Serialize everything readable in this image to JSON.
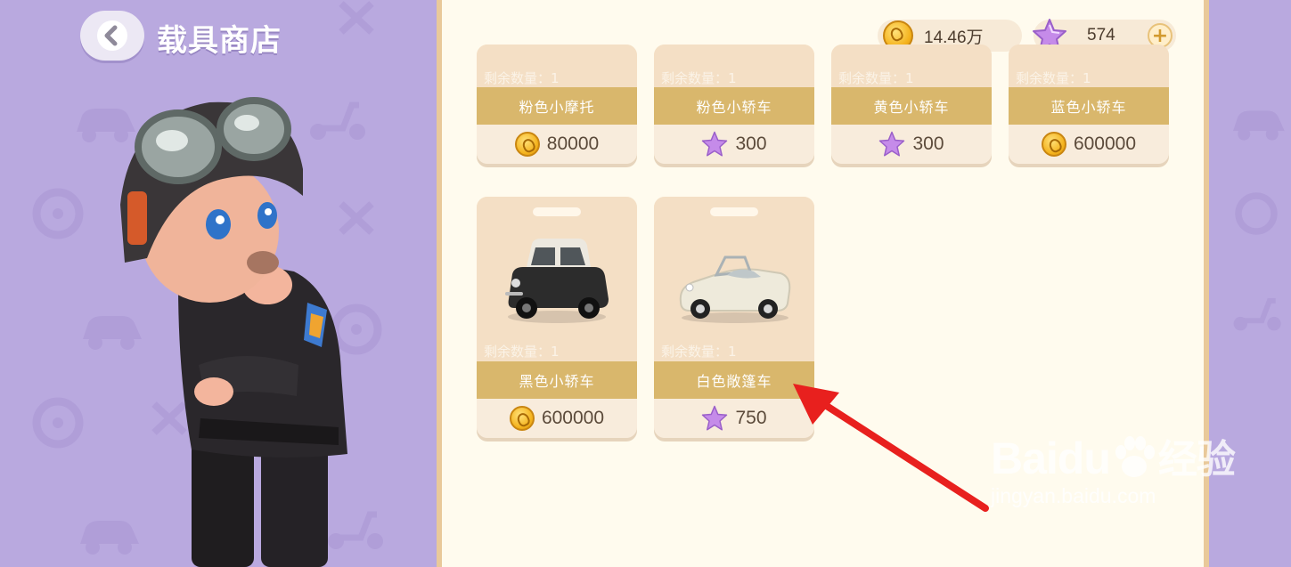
{
  "header": {
    "title": "载具商店"
  },
  "currency": {
    "coins": "14.46万",
    "stars": "574"
  },
  "colors": {
    "accent_gold": "#d9b76c",
    "panel_bg": "#fffbee",
    "left_bg": "#b9a9df",
    "arrow": "#e8201e"
  },
  "top_row": [
    {
      "stock": "剩余数量：1",
      "name": "粉色小摩托",
      "price_type": "coin",
      "price": "80000"
    },
    {
      "stock": "剩余数量：1",
      "name": "粉色小轿车",
      "price_type": "star",
      "price": "300"
    },
    {
      "stock": "剩余数量：1",
      "name": "黄色小轿车",
      "price_type": "star",
      "price": "300"
    },
    {
      "stock": "剩余数量：1",
      "name": "蓝色小轿车",
      "price_type": "coin",
      "price": "600000"
    }
  ],
  "bottom_row": [
    {
      "stock": "剩余数量：1",
      "name": "黑色小轿车",
      "price_type": "coin",
      "price": "600000"
    },
    {
      "stock": "剩余数量：1",
      "name": "白色敞篷车",
      "price_type": "star",
      "price": "750"
    }
  ],
  "watermark": {
    "brand": "Baidu",
    "cn": "经验",
    "url": "jingyan.baidu.com"
  }
}
